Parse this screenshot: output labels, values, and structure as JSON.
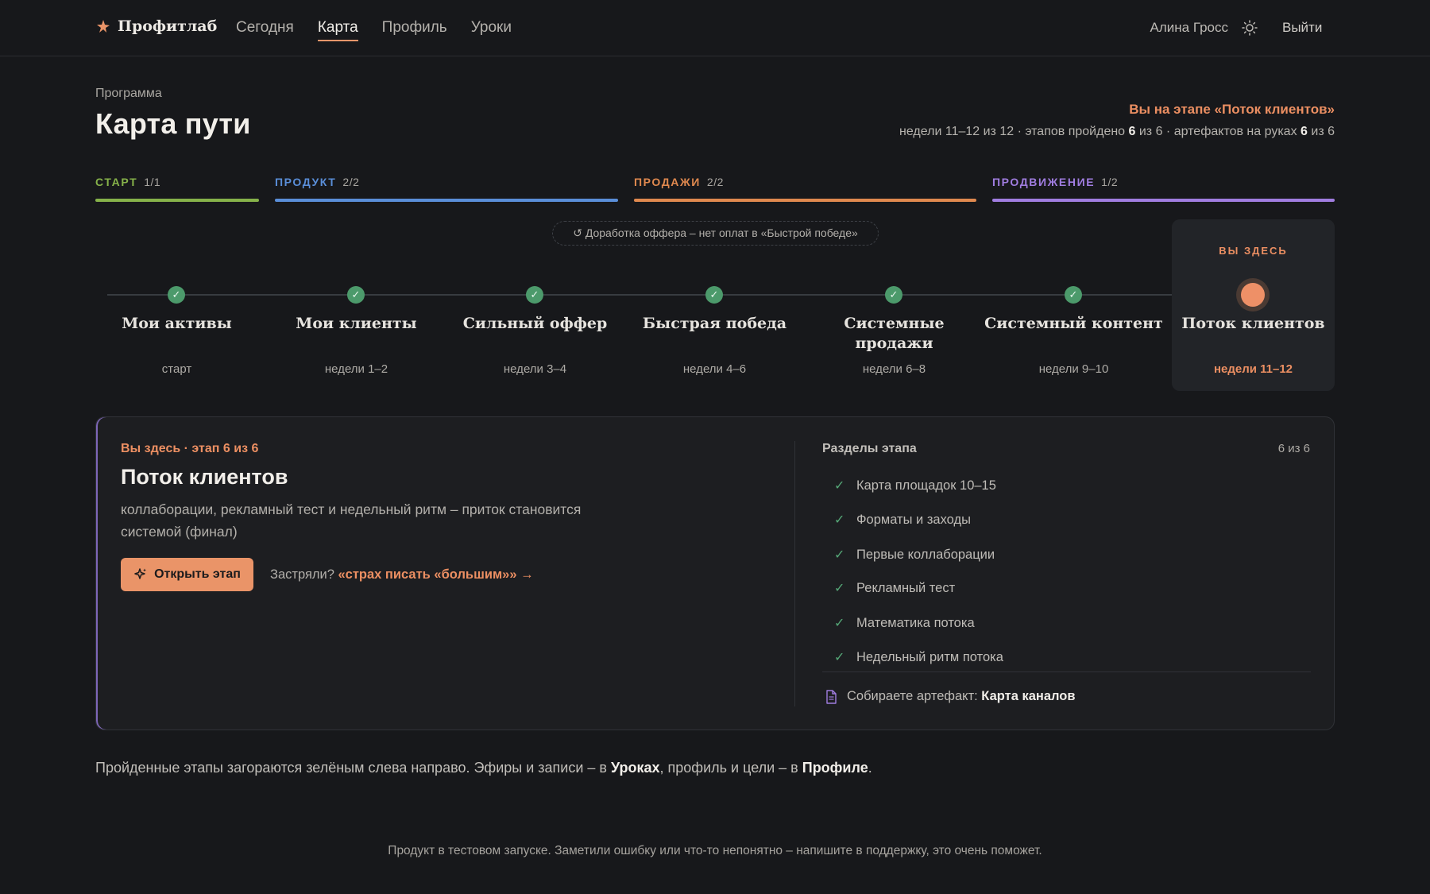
{
  "brand": {
    "name": "Профитлаб",
    "icon": "star-logo-icon",
    "accent": "#ea9468"
  },
  "nav": {
    "items": [
      {
        "label": "Сегодня",
        "active": false
      },
      {
        "label": "Карта",
        "active": true
      },
      {
        "label": "Профиль",
        "active": false
      },
      {
        "label": "Уроки",
        "active": false
      }
    ]
  },
  "user": {
    "name": "Алина Гросс",
    "theme_icon": "sun-icon",
    "logout": "Выйти"
  },
  "page": {
    "eyebrow": "Программа",
    "title": "Карта пути",
    "stage_now": "Вы на этапе «Поток клиентов»",
    "stats": {
      "weeks": "недели 11–12 из 12 · этапов пройдено ",
      "stages_done": "6",
      "stages_mid": " из 6 · артефактов на руках ",
      "artifacts": "6",
      "artifacts_tail": " из 6"
    }
  },
  "phases": [
    {
      "label": "СТАРТ",
      "count": "1/1",
      "color": "#86b24a"
    },
    {
      "label": "ПРОДУКТ",
      "count": "2/2",
      "color": "#5a8ed8"
    },
    {
      "label": "ПРОДАЖИ",
      "count": "2/2",
      "color": "#e0894f"
    },
    {
      "label": "ПРОДВИЖЕНИЕ",
      "count": "1/2",
      "color": "#a07de0"
    }
  ],
  "note": "↺ Доработка оффера – нет оплат в «Быстрой победе»",
  "timeline": {
    "here_label": "ВЫ ЗДЕСЬ",
    "stages": [
      {
        "name": "Мои активы",
        "weeks": "старт",
        "done": true
      },
      {
        "name": "Мои клиенты",
        "weeks": "недели 1–2",
        "done": true
      },
      {
        "name": "Сильный оффер",
        "weeks": "недели 3–4",
        "done": true
      },
      {
        "name": "Быстрая победа",
        "weeks": "недели 4–6",
        "done": true
      },
      {
        "name": "Системные продажи",
        "weeks": "недели 6–8",
        "done": true
      },
      {
        "name": "Системный контент",
        "weeks": "недели 9–10",
        "done": true
      },
      {
        "name": "Поток клиентов",
        "weeks": "недели 11–12",
        "done": false,
        "current": true
      }
    ],
    "check_glyph": "✓"
  },
  "card": {
    "eyebrow": "Вы здесь · этап 6 из 6",
    "title": "Поток клиентов",
    "desc": "коллаборации, рекламный тест и недельный ритм – приток становится системой (финал)",
    "open_button": "Открыть этап",
    "open_icon": "sparkle-icon",
    "stuck_prefix": "Застряли? ",
    "stuck_link": "«страх писать «большим»» →",
    "sections_title": "Разделы этапа",
    "sections_count": "6 из 6",
    "sections": [
      "Карта площадок 10–15",
      "Форматы и заходы",
      "Первые коллаборации",
      "Рекламный тест",
      "Математика потока",
      "Недельный ритм потока"
    ],
    "artifact_prefix": "Собираете артефакт: ",
    "artifact_name": "Карта каналов",
    "artifact_icon": "document-icon"
  },
  "hint": {
    "a": "Пройденные этапы загораются зелёным слева направо. Эфиры и записи – в ",
    "b": "Уроках",
    "c": ", профиль и цели – в ",
    "d": "Профиле",
    "e": "."
  },
  "footer": "Продукт в тестовом запуске. Заметили ошибку или что-то непонятно – напишите в поддержку, это очень поможет."
}
